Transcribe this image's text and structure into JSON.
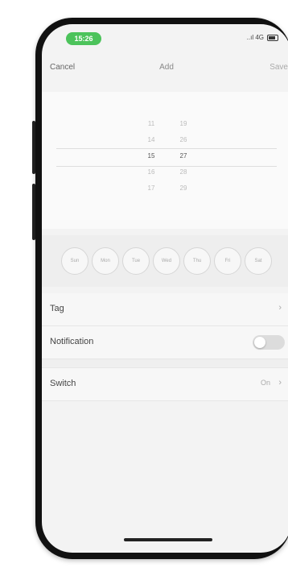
{
  "status_bar": {
    "time": "15:26",
    "signal": "..ıl 4G",
    "battery_icon": "battery-icon"
  },
  "nav": {
    "cancel": "Cancel",
    "title": "Add",
    "save": "Save"
  },
  "time_picker": {
    "hours": [
      "11",
      "14",
      "15",
      "16",
      "17"
    ],
    "minutes": [
      "19",
      "26",
      "27",
      "28",
      "29"
    ],
    "selected_hour": "15",
    "selected_minute": "27"
  },
  "days": [
    "Sun",
    "Mon",
    "Tue",
    "Wed",
    "Thu",
    "Fri",
    "Sat"
  ],
  "settings": {
    "tag_label": "Tag",
    "notification_label": "Notification",
    "notification_enabled": false,
    "switch_label": "Switch",
    "switch_value": "On"
  },
  "colors": {
    "time_pill": "#4cc35b"
  }
}
